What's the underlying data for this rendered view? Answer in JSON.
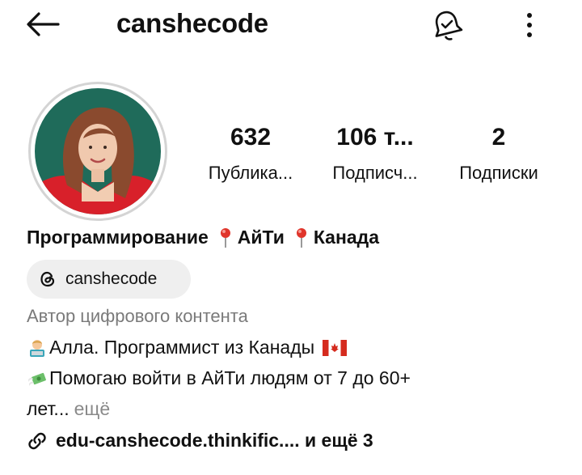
{
  "header": {
    "username": "canshecode"
  },
  "stats": {
    "posts": {
      "value": "632",
      "label": "Публика..."
    },
    "followers": {
      "value": "106 т...",
      "label": "Подписч..."
    },
    "following": {
      "value": "2",
      "label": "Подписки"
    }
  },
  "profile": {
    "name_parts": [
      "Программирование",
      "АйТи",
      "Канада"
    ],
    "threads_handle": "canshecode",
    "category": "Автор цифрового контента",
    "bio_line1": "Алла. Программист из Канады",
    "bio_line2": "Помогаю войти в АйТи людям от 7 до 60+",
    "bio_line3": "лет...",
    "more_label": "ещё",
    "link_text": "edu-canshecode.thinkific.... и ещё 3"
  },
  "icons": {
    "back": "arrow-left-icon",
    "notifications": "bell-check-icon",
    "more": "more-vertical-icon",
    "threads": "threads-icon",
    "pin": "round-pushpin-icon",
    "link": "link-icon"
  },
  "colors": {
    "text": "#111111",
    "secondary": "#7a7a7a",
    "chip_bg": "#efefef",
    "pin_red": "#e0352b",
    "avatar_bg": "#1f6b5a",
    "jacket_red": "#d8202a"
  }
}
